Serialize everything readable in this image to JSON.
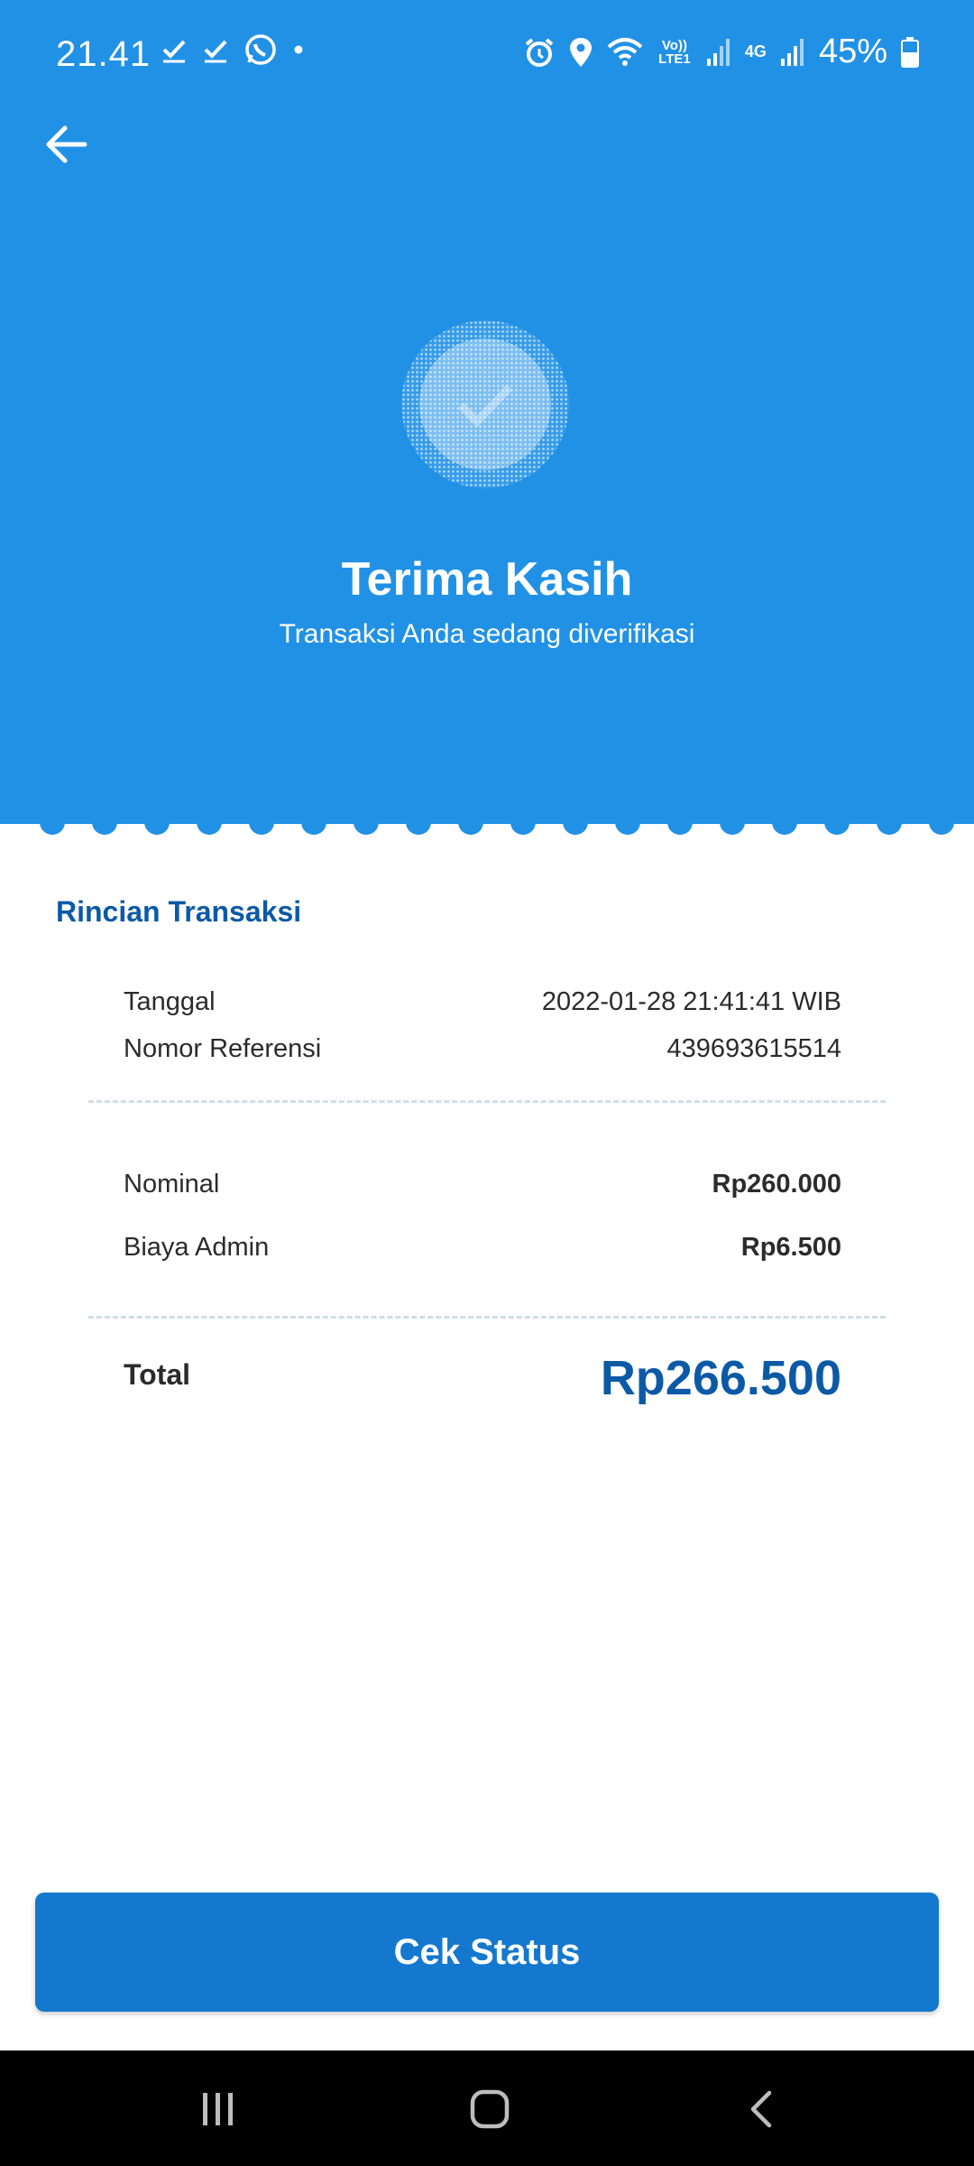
{
  "status_bar": {
    "time": "21.41",
    "battery": "45%",
    "network_4g": "4G",
    "volte": "Vo)) LTE1"
  },
  "header": {
    "title": "Terima Kasih",
    "subtitle": "Transaksi Anda sedang diverifikasi",
    "accent_color": "#2191e6"
  },
  "details": {
    "section_title": "Rincian Transaksi",
    "rows": [
      {
        "label": "Tanggal",
        "value": "2022-01-28 21:41:41 WIB"
      },
      {
        "label": "Nomor Referensi",
        "value": "439693615514"
      }
    ],
    "amounts": [
      {
        "label": "Nominal",
        "value": "Rp260.000"
      },
      {
        "label": "Biaya Admin",
        "value": "Rp6.500"
      }
    ],
    "total": {
      "label": "Total",
      "value": "Rp266.500"
    }
  },
  "cta": {
    "label": "Cek Status",
    "color": "#1478cf"
  },
  "icons": [
    "back-arrow-icon",
    "check-icon",
    "recents-icon",
    "home-icon",
    "back-icon"
  ]
}
